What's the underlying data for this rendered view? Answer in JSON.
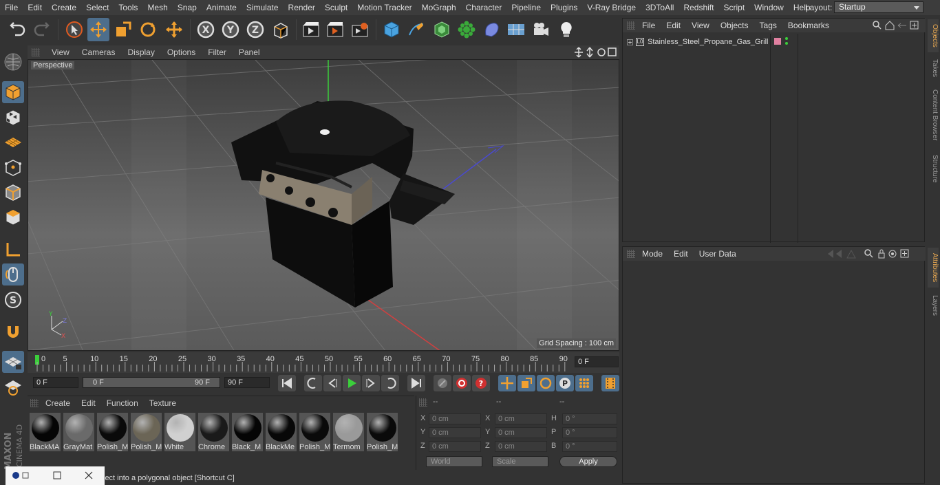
{
  "menubar": {
    "items": [
      "File",
      "Edit",
      "Create",
      "Select",
      "Tools",
      "Mesh",
      "Snap",
      "Animate",
      "Simulate",
      "Render",
      "Sculpt",
      "Motion Tracker",
      "MoGraph",
      "Character",
      "Pipeline",
      "Plugins",
      "V-Ray Bridge",
      "3DToAll",
      "Redshift",
      "Script",
      "Window",
      "Help"
    ]
  },
  "layout": {
    "label": "Layout:",
    "value": "Startup"
  },
  "viewport": {
    "menu": [
      "View",
      "Cameras",
      "Display",
      "Options",
      "Filter",
      "Panel"
    ],
    "label": "Perspective",
    "grid_spacing": "Grid Spacing : 100 cm"
  },
  "timeline": {
    "ticks": [
      "0",
      "5",
      "10",
      "15",
      "20",
      "25",
      "30",
      "35",
      "40",
      "45",
      "50",
      "55",
      "60",
      "65",
      "70",
      "75",
      "80",
      "85",
      "90"
    ],
    "current_frame": "0 F"
  },
  "transport": {
    "start": "0 F",
    "range_start": "0 F",
    "range_end": "90 F",
    "end": "90 F"
  },
  "materials": {
    "menu": [
      "Create",
      "Edit",
      "Function",
      "Texture"
    ],
    "items": [
      {
        "name": "BlackMA",
        "color": "#050505"
      },
      {
        "name": "GrayMat",
        "color": "#6a6a6a"
      },
      {
        "name": "Polish_M",
        "color": "#0a0a0a"
      },
      {
        "name": "Polish_M",
        "color": "#6b6556"
      },
      {
        "name": "White",
        "color": "#d0d0d0"
      },
      {
        "name": "Chrome",
        "color": "#1a1a1a"
      },
      {
        "name": "Black_M",
        "color": "#050505"
      },
      {
        "name": "BlackMe",
        "color": "#080808"
      },
      {
        "name": "Polish_M",
        "color": "#0a0a0a"
      },
      {
        "name": "Termom",
        "color": "#9a9a9a"
      },
      {
        "name": "Polish_M",
        "color": "#0a0a0a"
      }
    ]
  },
  "coords": {
    "headers": [
      "--",
      "--",
      "--"
    ],
    "rows": [
      {
        "a": "X",
        "av": "0 cm",
        "b": "X",
        "bv": "0 cm",
        "c": "H",
        "cv": "0 °"
      },
      {
        "a": "Y",
        "av": "0 cm",
        "b": "Y",
        "bv": "0 cm",
        "c": "P",
        "cv": "0 °"
      },
      {
        "a": "Z",
        "av": "0 cm",
        "b": "Z",
        "bv": "0 cm",
        "c": "B",
        "cv": "0 °"
      }
    ],
    "world": "World",
    "scale": "Scale",
    "apply": "Apply"
  },
  "status": "ject into a polygonal object [Shortcut C]",
  "object_manager": {
    "menu": [
      "File",
      "Edit",
      "View",
      "Objects",
      "Tags",
      "Bookmarks"
    ],
    "object": "Stainless_Steel_Propane_Gas_Grill"
  },
  "attribute_manager": {
    "menu": [
      "Mode",
      "Edit",
      "User Data"
    ]
  },
  "side_tabs": [
    "Objects",
    "Takes",
    "Content Browser",
    "Structure",
    "Attributes",
    "Layers"
  ],
  "brand": {
    "line1": "MAXON",
    "line2": "CINEMA 4D"
  },
  "colors": {
    "accent": "#4d6e8c",
    "tab_active": "#e8a850"
  }
}
